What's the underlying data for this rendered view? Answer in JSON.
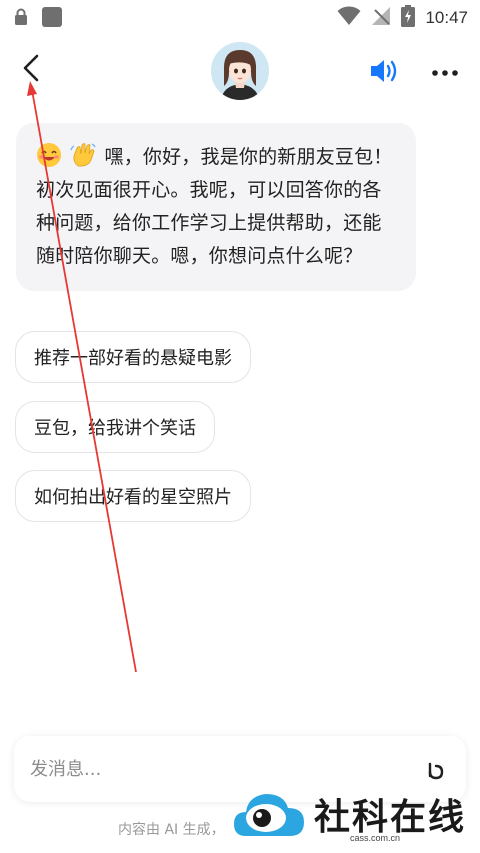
{
  "status_bar": {
    "time": "10:47",
    "icons": [
      "lock-icon",
      "app-icon",
      "wifi-icon",
      "no-signal-icon",
      "battery-charging-icon"
    ]
  },
  "header": {
    "back_icon": "chevron-left-icon",
    "avatar": "assistant-avatar",
    "speaker_icon": "speaker-icon",
    "more_icon": "more-dots-icon",
    "accent_color": "#1677ff"
  },
  "chat": {
    "bot_message": {
      "emojis": [
        "smile-emoji",
        "wave-emoji"
      ],
      "text": "嘿，你好，我是你的新朋友豆包！初次见面很开心。我呢，可以回答你的各种问题，给你工作学习上提供帮助，还能随时陪你聊天。嗯，你想问点什么呢？"
    },
    "suggestions": [
      "推荐一部好看的悬疑电影",
      "豆包，给我讲个笑话",
      "如何拍出好看的星空照片"
    ]
  },
  "composer": {
    "placeholder": "发消息...",
    "voice_icon": "voice-input-icon"
  },
  "disclaimer": "内容由 AI 生成，",
  "watermark": {
    "title": "社科在线",
    "url": "cass.com.cn"
  },
  "annotation": {
    "color": "#e53935",
    "type": "arrow-to-back-button"
  }
}
